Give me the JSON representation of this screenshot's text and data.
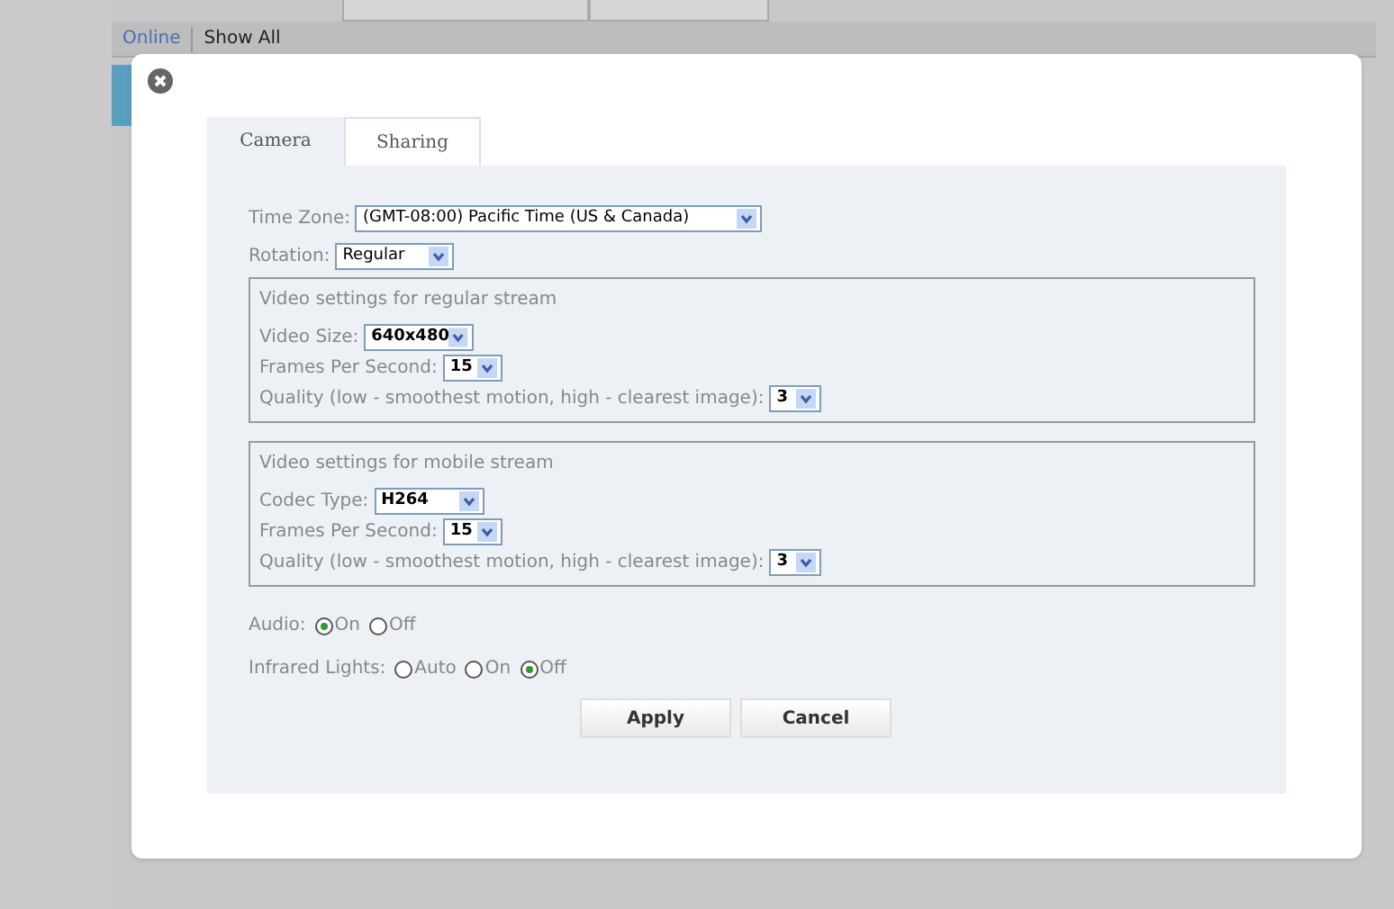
{
  "filters": [
    {
      "label": "Online",
      "selected": true
    },
    {
      "label": "Show All",
      "selected": false
    }
  ],
  "tabs": [
    {
      "label": "Camera",
      "selected": true
    },
    {
      "label": "Sharing",
      "selected": false
    }
  ],
  "fields": [
    {
      "label": "Time Zone:",
      "value": "(GMT-08:00) Pacific Time (US & Canada)"
    },
    {
      "label": "Rotation:",
      "value": "Regular"
    }
  ],
  "groups": [
    {
      "title": "Video settings for regular stream",
      "fields": [
        {
          "label": "Video Size:",
          "value": "640x480"
        },
        {
          "label": "Frames Per Second:",
          "value": "15"
        },
        {
          "label": "Quality (low - smoothest motion, high - clearest image):",
          "value": "3"
        }
      ]
    },
    {
      "title": "Video settings for mobile stream",
      "fields": [
        {
          "label": "Codec Type:",
          "value": "H264"
        },
        {
          "label": "Frames Per Second:",
          "value": "15"
        },
        {
          "label": "Quality (low - smoothest motion, high - clearest image):",
          "value": "3"
        }
      ]
    }
  ],
  "radio_groups": [
    {
      "label": "Audio:",
      "options": [
        {
          "label": "On",
          "selected": true
        },
        {
          "label": "Off",
          "selected": false
        }
      ]
    },
    {
      "label": "Infrared Lights:",
      "options": [
        {
          "label": "Auto",
          "selected": false
        },
        {
          "label": "On",
          "selected": false
        },
        {
          "label": "Off",
          "selected": true
        }
      ]
    }
  ],
  "buttons": [
    "Apply",
    "Cancel"
  ]
}
